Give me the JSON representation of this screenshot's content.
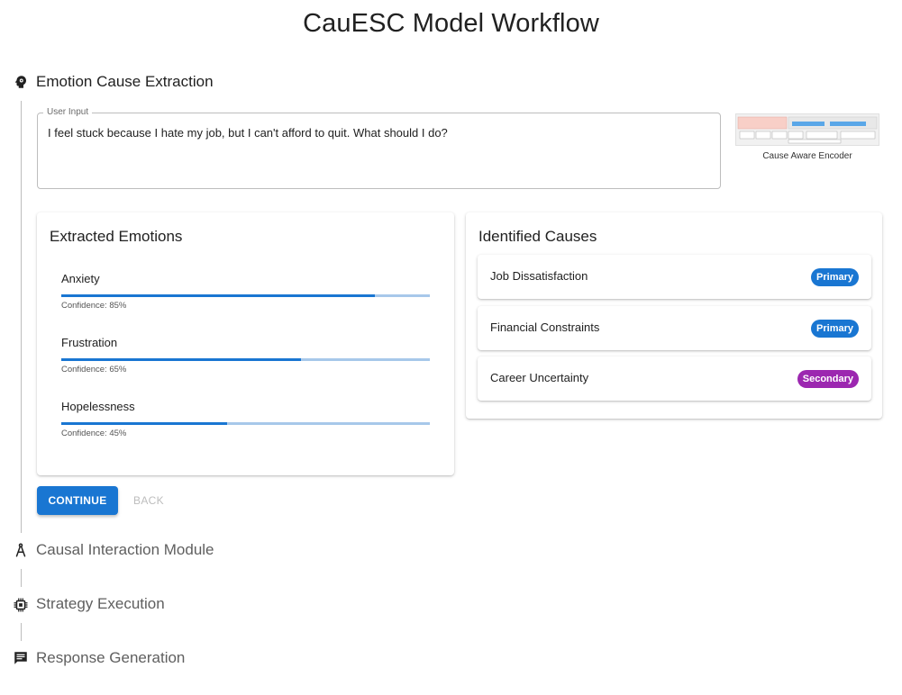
{
  "title": "CauESC Model Workflow",
  "steps": [
    {
      "label": "Emotion Cause Extraction",
      "icon": "psychology-icon",
      "state": "active"
    },
    {
      "label": "Causal Interaction Module",
      "icon": "compass-icon",
      "state": "inactive"
    },
    {
      "label": "Strategy Execution",
      "icon": "memory-chip-icon",
      "state": "inactive"
    },
    {
      "label": "Response Generation",
      "icon": "chat-bubble-icon",
      "state": "inactive"
    }
  ],
  "user_input": {
    "legend": "User Input",
    "value": "I feel stuck because I hate my job, but I can't afford to quit. What should I do?"
  },
  "encoder": {
    "caption": "Cause Aware Encoder"
  },
  "emotions": {
    "title": "Extracted Emotions",
    "items": [
      {
        "name": "Anxiety",
        "confidence_text": "Confidence: 85%",
        "value": 0.85
      },
      {
        "name": "Frustration",
        "confidence_text": "Confidence: 65%",
        "value": 0.65
      },
      {
        "name": "Hopelessness",
        "confidence_text": "Confidence: 45%",
        "value": 0.45
      }
    ]
  },
  "causes": {
    "title": "Identified Causes",
    "items": [
      {
        "label": "Job Dissatisfaction",
        "badge": "Primary",
        "badge_color": "#1976d2"
      },
      {
        "label": "Financial Constraints",
        "badge": "Primary",
        "badge_color": "#1976d2"
      },
      {
        "label": "Career Uncertainty",
        "badge": "Secondary",
        "badge_color": "#9c27b0"
      }
    ]
  },
  "buttons": {
    "continue": "CONTINUE",
    "back": "BACK"
  },
  "colors": {
    "primary": "#1976d2",
    "secondary": "#9c27b0",
    "bar_track": "#a7c8ea"
  }
}
